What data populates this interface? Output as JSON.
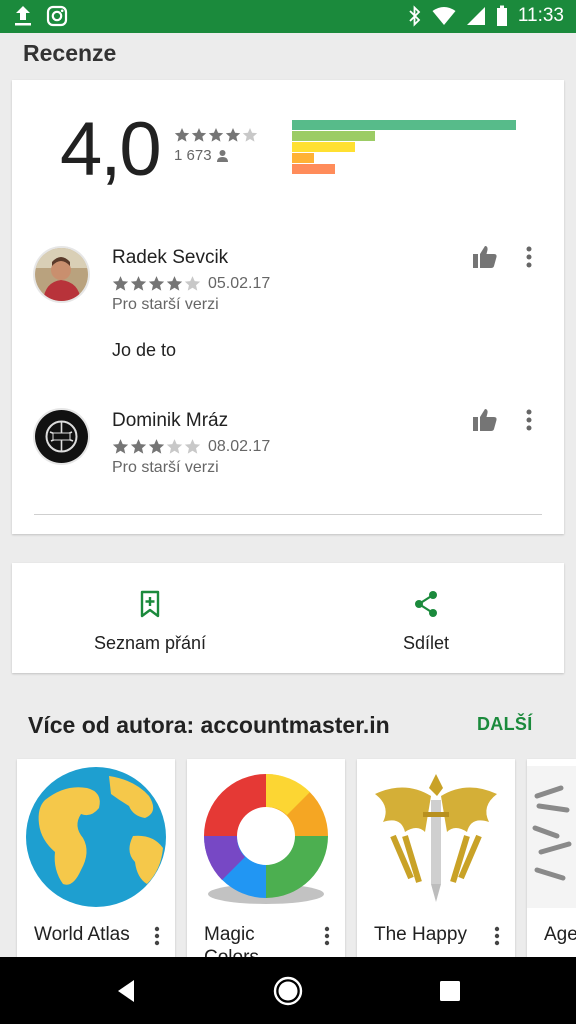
{
  "status_bar": {
    "time": "11:33",
    "left_icons": [
      "upload-icon",
      "instagram-icon"
    ],
    "right_icons": [
      "bluetooth-icon",
      "wifi-icon",
      "cell-signal-icon",
      "battery-icon"
    ]
  },
  "reviews": {
    "title": "Recenze",
    "average": "4,0",
    "average_stars": 4,
    "count": "1 673",
    "histogram": [
      {
        "stars": 5,
        "fraction": 1.0,
        "color": "#57bb8a"
      },
      {
        "stars": 4,
        "fraction": 0.37,
        "color": "#9ccc65"
      },
      {
        "stars": 3,
        "fraction": 0.28,
        "color": "#ffe031"
      },
      {
        "stars": 2,
        "fraction": 0.1,
        "color": "#ffb235"
      },
      {
        "stars": 1,
        "fraction": 0.19,
        "color": "#ff8c5a"
      }
    ],
    "items": [
      {
        "name": "Radek Sevcik",
        "rating": 4,
        "date": "05.02.17",
        "version": "Pro starší verzi",
        "text": "Jo de to"
      },
      {
        "name": "Dominik Mráz",
        "rating": 3,
        "date": "08.02.17",
        "version": "Pro starší verzi",
        "text": ""
      }
    ]
  },
  "actions": {
    "wishlist_label": "Seznam přání",
    "share_label": "Sdílet"
  },
  "more_from": {
    "title": "Více od autora: accountmaster.in",
    "link": "DALŠÍ",
    "apps": [
      {
        "title": "World Atlas"
      },
      {
        "title": "Magic Colors"
      },
      {
        "title": "The Happy"
      },
      {
        "title": "Age ulat"
      }
    ]
  },
  "colors": {
    "accent": "#1b8a3c",
    "star_filled": "#757575",
    "star_empty": "#c8c8c8"
  }
}
